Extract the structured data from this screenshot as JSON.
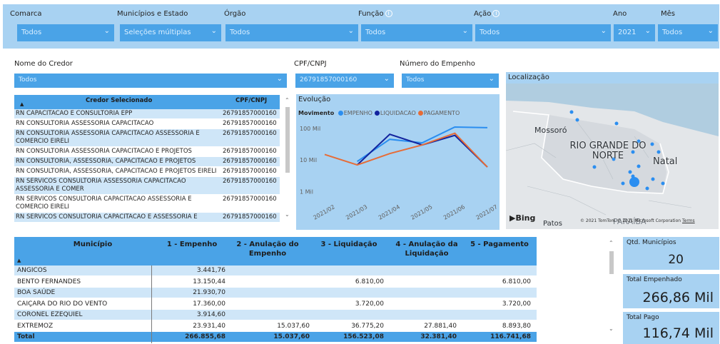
{
  "filters": {
    "comarca": {
      "label": "Comarca",
      "value": "Todos"
    },
    "municipios": {
      "label": "Municípios e Estado",
      "value": "Seleções múltiplas"
    },
    "orgao": {
      "label": "Órgão",
      "value": "Todos"
    },
    "funcao": {
      "label": "Função",
      "value": "Todos"
    },
    "acao": {
      "label": "Ação",
      "value": "Todos"
    },
    "ano": {
      "label": "Ano",
      "value": "2021"
    },
    "mes": {
      "label": "Mês",
      "value": "Todos"
    }
  },
  "filters2": {
    "credor": {
      "label": "Nome do Credor",
      "value": "Todos"
    },
    "cpf": {
      "label": "CPF/CNPJ",
      "value": "26791857000160"
    },
    "empenho": {
      "label": "Número do Empenho",
      "value": "Todos"
    }
  },
  "credor_table": {
    "headers": [
      "Credor Selecionado",
      "CPF/CNPJ"
    ],
    "rows": [
      {
        "name": "RN CAPACITACAO E CONSULTORIA EPP",
        "cpf": "26791857000160"
      },
      {
        "name": "RN CONSULTORIA ASSESSORIA CAPACITACAO",
        "cpf": "26791857000160"
      },
      {
        "name": "RN CONSULTORIA ASSESSORIA CAPACITACAO ASSESSORIA E COMERCIO EIRELI",
        "cpf": "26791857000160"
      },
      {
        "name": "RN CONSULTORIA ASSESSORIA CAPACITACAO E PROJETOS",
        "cpf": "26791857000160"
      },
      {
        "name": "RN CONSULTORIA, ASSESSORIA, CAPACITACAO E PROJETOS",
        "cpf": "26791857000160"
      },
      {
        "name": "RN CONSULTORIA, ASSESSORIA, CAPACITACAO E PROJETOS EIRELI",
        "cpf": "26791857000160"
      },
      {
        "name": "RN SERVICOS CONSULTORIA ASSESSORIA CAPACITACAO ASSESSORIA E COMER",
        "cpf": "26791857000160"
      },
      {
        "name": "RN SERVICOS CONSULTORIA CAPACITACAO ASSESSORIA E COMERCIO EIRELI",
        "cpf": "26791857000160"
      },
      {
        "name": "RN SERVICOS CONSULTORIA CAPACITACAO E ASSESSORIA E",
        "cpf": "26791857000160"
      }
    ]
  },
  "chart_data": {
    "type": "line",
    "title": "Evolução",
    "legend_title": "Movimento",
    "x": [
      "2021/02",
      "2021/03",
      "2021/04",
      "2021/05",
      "2021/06",
      "2021/07"
    ],
    "yscale": "log",
    "yticks": [
      "1 Mil",
      "10 Mil",
      "100 Mil"
    ],
    "ylim": [
      500,
      150000
    ],
    "series": [
      {
        "name": "EMPENHO",
        "color": "#2b8ef0",
        "values": [
          null,
          9000,
          45000,
          35000,
          110000,
          105000
        ]
      },
      {
        "name": "LIQUIDACAO",
        "color": "#12239e",
        "values": [
          null,
          7000,
          65000,
          30000,
          60000,
          6000
        ]
      },
      {
        "name": "PAGAMENTO",
        "color": "#e66c37",
        "values": [
          15000,
          7000,
          16000,
          30000,
          70000,
          6000
        ]
      }
    ]
  },
  "map": {
    "title": "Localização",
    "labels": {
      "mossoro": "Mossoró",
      "state": "RIO GRANDE DO NORTE",
      "natal": "Natal",
      "patos": "Patos",
      "paraiba": "PARAÍBA"
    },
    "logo": "Bing",
    "copyright": "© 2021 TomTom © 2021 Microsoft Corporation",
    "terms": "Terms"
  },
  "muni_table": {
    "headers": [
      "Município",
      "1 - Empenho",
      "2 - Anulação do Empenho",
      "3 - Liquidação",
      "4 - Anulação da Liquidação",
      "5 - Pagamento"
    ],
    "rows": [
      [
        "ANGICOS",
        "3.441,76",
        "",
        "",
        "",
        ""
      ],
      [
        "BENTO FERNANDES",
        "13.150,44",
        "",
        "6.810,00",
        "",
        "6.810,00"
      ],
      [
        "BOA SAÚDE",
        "21.930,70",
        "",
        "",
        "",
        ""
      ],
      [
        "CAIÇARA DO RIO DO VENTO",
        "17.360,00",
        "",
        "3.720,00",
        "",
        "3.720,00"
      ],
      [
        "CORONEL EZEQUIEL",
        "3.914,60",
        "",
        "",
        "",
        ""
      ],
      [
        "EXTREMOZ",
        "23.931,40",
        "15.037,60",
        "36.775,20",
        "27.881,40",
        "8.893,80"
      ]
    ],
    "total": [
      "Total",
      "266.855,68",
      "15.037,60",
      "156.523,08",
      "32.381,40",
      "116.741,68"
    ]
  },
  "kpis": [
    {
      "title": "Qtd. Municípios",
      "value": "20"
    },
    {
      "title": "Total Empenhado",
      "value": "266,86 Mil"
    },
    {
      "title": "Total Pago",
      "value": "116,74 Mil"
    }
  ]
}
